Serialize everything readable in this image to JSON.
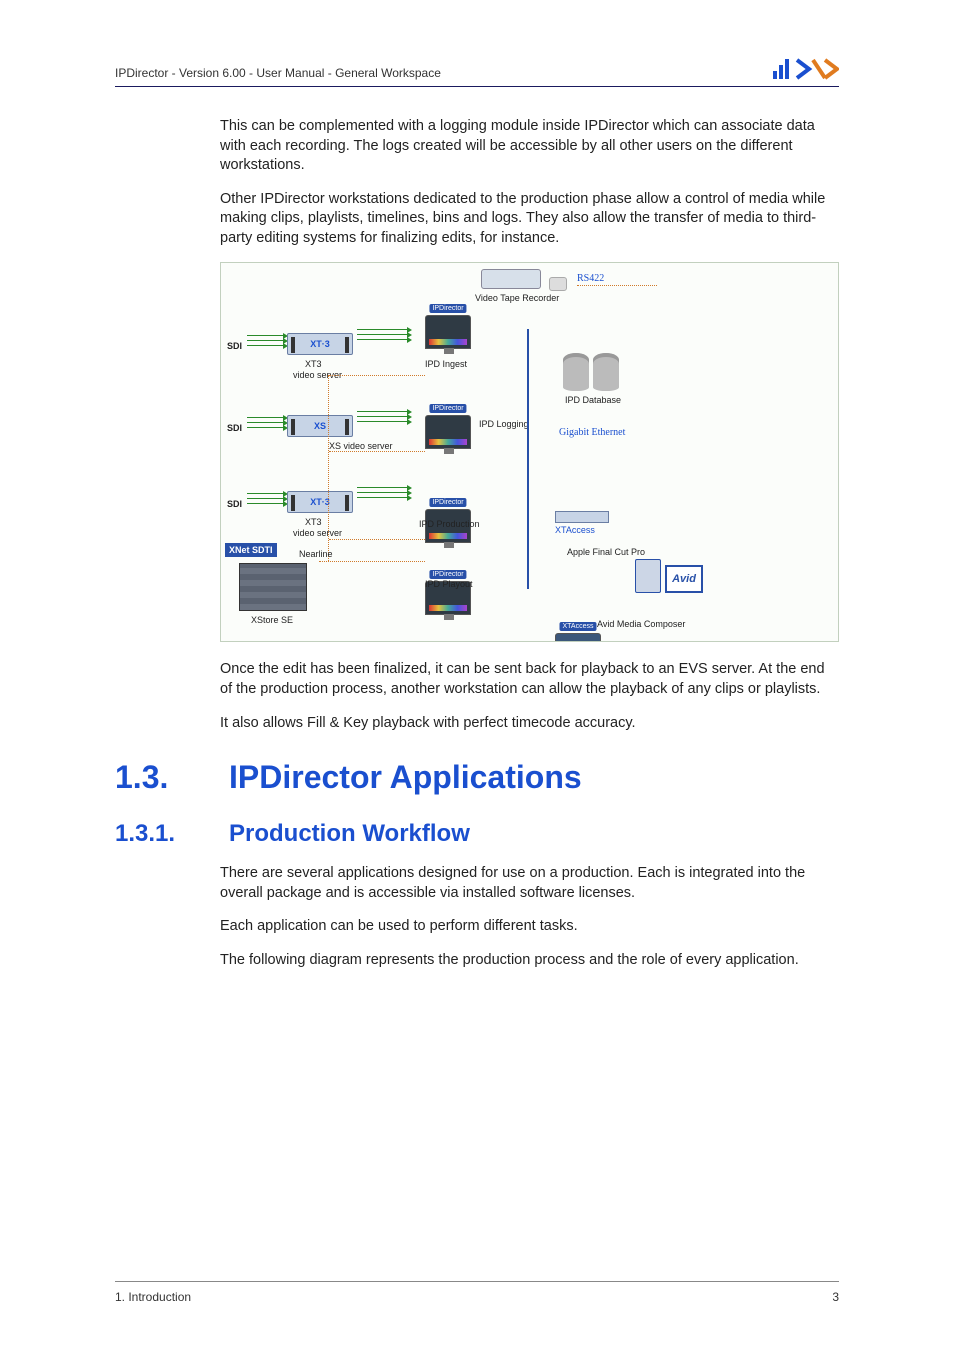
{
  "header": {
    "breadcrumb": "IPDirector - Version 6.00 - User Manual - General Workspace",
    "logo_alt": "EVS"
  },
  "paragraphs": {
    "p1": "This can be complemented with a logging module inside IPDirector which can associate data with each recording. The logs created will be accessible by all other users on the different workstations.",
    "p2": "Other IPDirector workstations dedicated to the production phase allow a control of media while making clips, playlists, timelines, bins and logs. They also allow the transfer of media to third-party editing systems for finalizing edits, for instance.",
    "p3": "Once the edit has been finalized, it can be sent back for playback to an EVS server. At the end of the production process, another workstation can allow the playback of any clips or playlists.",
    "p4": "It also allows Fill & Key playback with perfect timecode accuracy.",
    "p5": "There are several applications designed for use on a production. Each is integrated into the overall package and is accessible via installed software licenses.",
    "p6": "Each application can be used to perform different tasks.",
    "p7": "The following diagram represents the production process and the role of every application."
  },
  "headings": {
    "h1_num": "1.3.",
    "h1_text": "IPDirector Applications",
    "h2_num": "1.3.1.",
    "h2_text": "Production Workflow"
  },
  "diagram": {
    "rs422": "RS422",
    "vtr": "Video Tape Recorder",
    "ipd_ingest": "IPD Ingest",
    "ipd_logging": "IPD Logging",
    "ipd_production": "IPD Production",
    "ipd_playout": "IPD Playout",
    "ipd_database": "IPD Database",
    "gigabit": "Gigabit Ethernet",
    "xt3": "XT3",
    "xt3_sub": "video server",
    "xs": "XS",
    "xs_sub": "XS video server",
    "sdi": "SDI",
    "xnet": "XNet SDTI",
    "nearline": "Nearline",
    "xstore": "XStore SE",
    "xtaccess_top": "XTAccess",
    "xtaccess_srv": "XTAccess",
    "apple": "Apple Final Cut Pro",
    "avid": "Avid",
    "avid_caption": "Avid Media Composer",
    "ipd_tag": "IPDirector",
    "xt3_label": "XT·3",
    "xs_label": "XS"
  },
  "footer": {
    "section": "1. Introduction",
    "page": "3"
  }
}
